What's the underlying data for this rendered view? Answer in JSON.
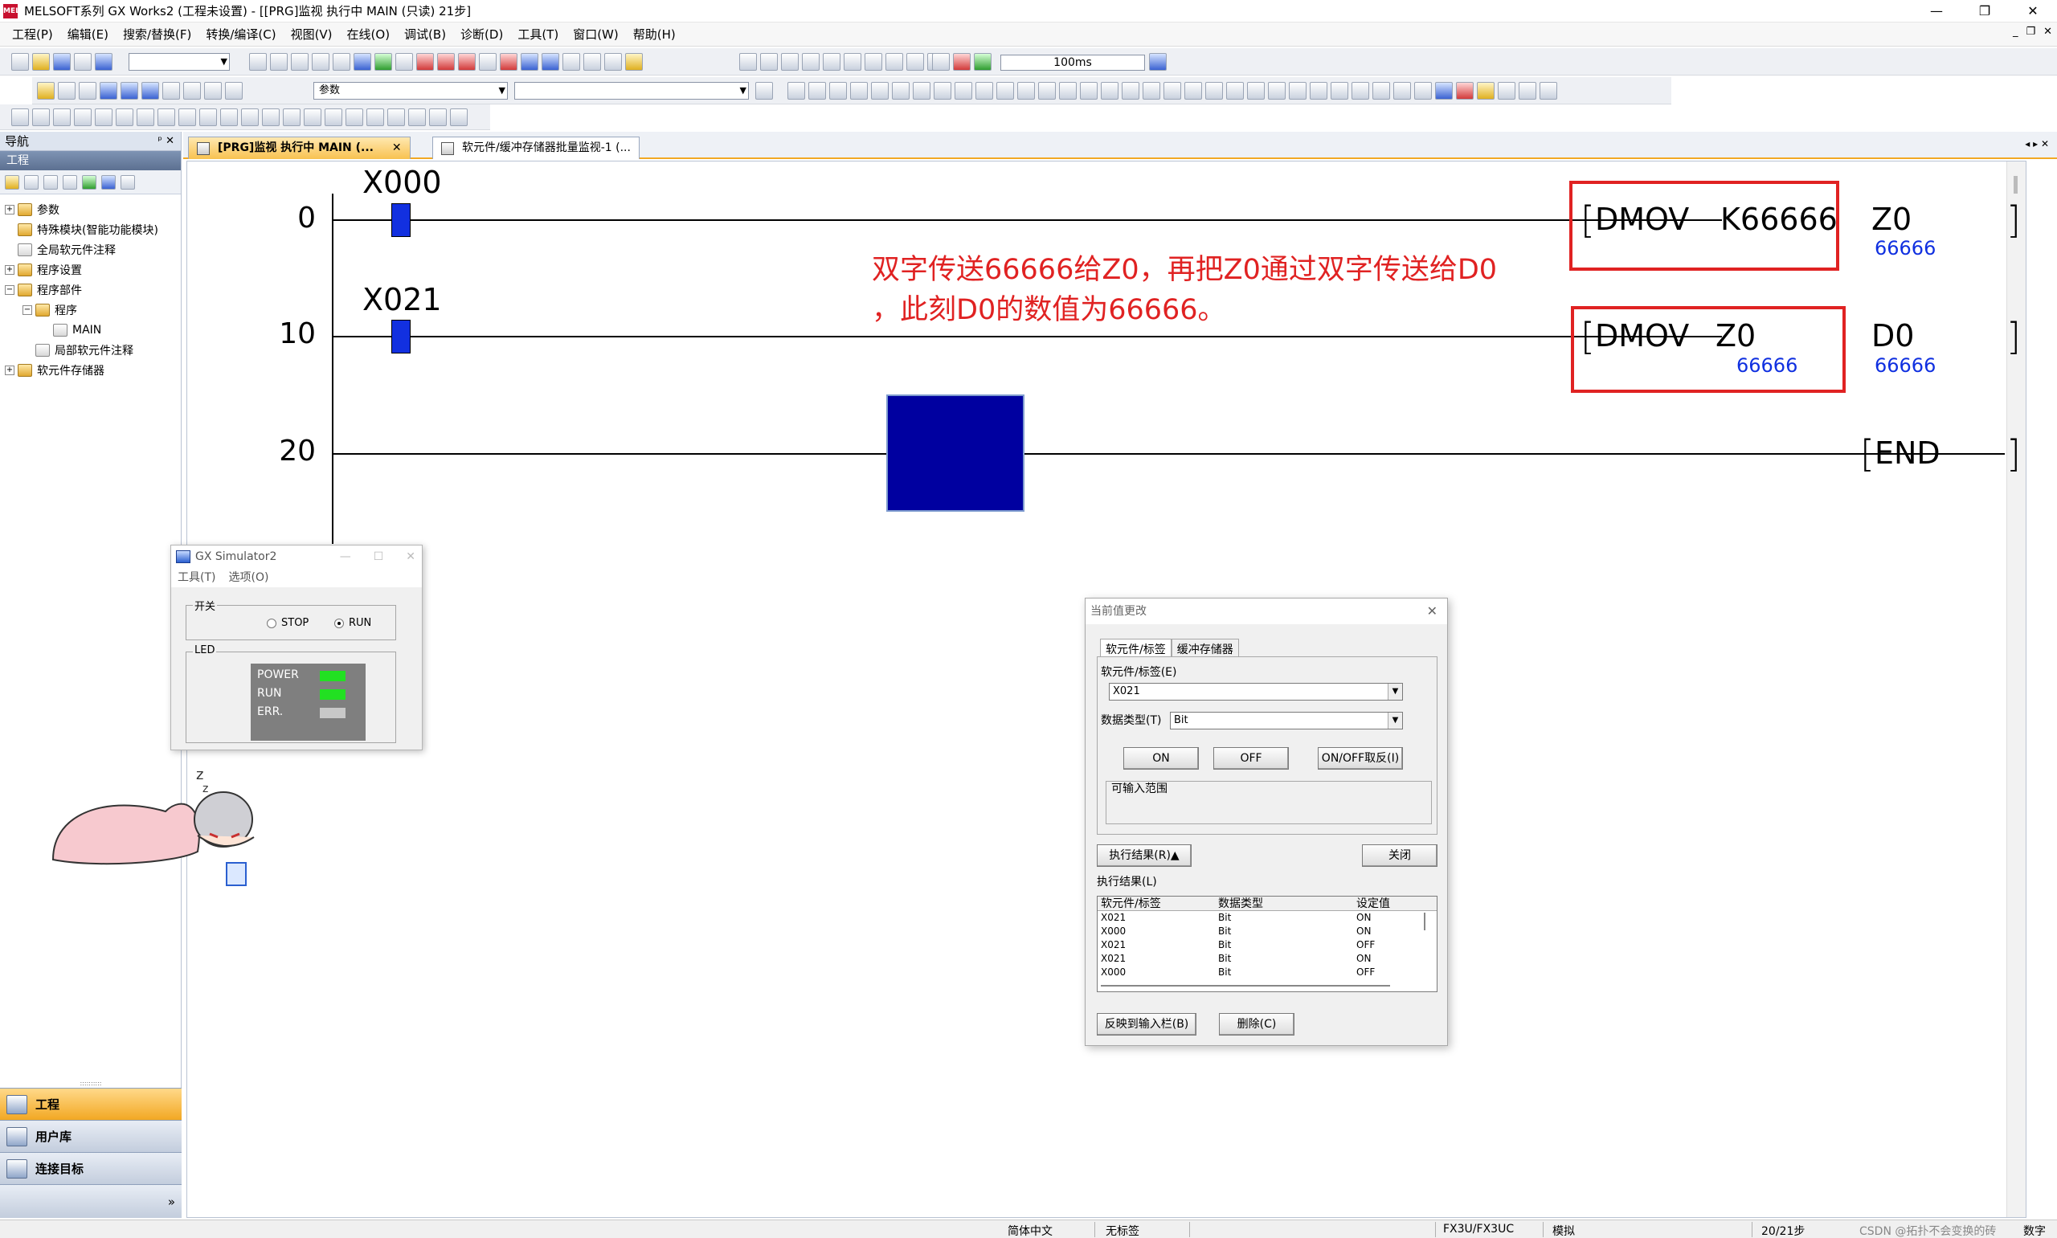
{
  "window": {
    "title": "MELSOFT系列 GX Works2 (工程未设置) - [[PRG]监视 执行中 MAIN (只读) 21步]",
    "app_icon_text": "MEL",
    "minimize": "—",
    "restore": "❐",
    "close": "✕"
  },
  "menu": [
    "工程(P)",
    "编辑(E)",
    "搜索/替换(F)",
    "转换/编译(C)",
    "视图(V)",
    "在线(O)",
    "调试(B)",
    "诊断(D)",
    "工具(T)",
    "窗口(W)",
    "帮助(H)"
  ],
  "mdi": {
    "minimize": "_",
    "restore": "❐",
    "close": "✕"
  },
  "toolbar": {
    "scan_time": "100ms",
    "param_combo": "参数"
  },
  "nav": {
    "title": "导航",
    "pin": "ᵖ ✕",
    "section": "工程",
    "tree": [
      {
        "label": "参数",
        "exp": "+",
        "indent": 0,
        "doc": false
      },
      {
        "label": "特殊模块(智能功能模块)",
        "exp": "",
        "indent": 0,
        "doc": false
      },
      {
        "label": "全局软元件注释",
        "exp": "",
        "indent": 0,
        "doc": true
      },
      {
        "label": "程序设置",
        "exp": "+",
        "indent": 0,
        "doc": false
      },
      {
        "label": "程序部件",
        "exp": "−",
        "indent": 0,
        "doc": false
      },
      {
        "label": "程序",
        "exp": "−",
        "indent": 1,
        "doc": false
      },
      {
        "label": "MAIN",
        "exp": "",
        "indent": 2,
        "doc": true
      },
      {
        "label": "局部软元件注释",
        "exp": "",
        "indent": 1,
        "doc": true
      },
      {
        "label": "软元件存储器",
        "exp": "+",
        "indent": 0,
        "doc": false
      }
    ],
    "buttons": [
      "工程",
      "用户库",
      "连接目标"
    ],
    "more": "»"
  },
  "tabs": [
    {
      "label": "[PRG]监视 执行中 MAIN (...",
      "close": "✕"
    },
    {
      "label": "软元件/缓冲存储器批量监视-1 (..."
    }
  ],
  "tab_scroll": "◂ ▸ ✕",
  "ladder": {
    "steps": [
      "0",
      "10",
      "20"
    ],
    "contacts": [
      "X000",
      "X021"
    ],
    "rung0": {
      "inst": "DMOV",
      "src": "K66666",
      "dst": "Z0",
      "dst_val": "66666"
    },
    "rung1": {
      "inst": "DMOV",
      "src": "Z0",
      "src_val": "66666",
      "dst": "D0",
      "dst_val": "66666"
    },
    "end": "END",
    "bracket_open": "[",
    "bracket_close": "]",
    "annotation_line1": "双字传送66666给Z0，再把Z0通过双字传送给D0",
    "annotation_line2": "，此刻D0的数值为66666。"
  },
  "simulator": {
    "title": "GX Simulator2",
    "buttons": {
      "min": "—",
      "max": "☐",
      "close": "✕"
    },
    "menu": [
      "工具(T)",
      "选项(O)"
    ],
    "switch_label": "开关",
    "stop": "STOP",
    "run": "RUN",
    "led_label": "LED",
    "leds": [
      {
        "name": "POWER",
        "color": "#22e022"
      },
      {
        "name": "RUN",
        "color": "#22e022"
      },
      {
        "name": "ERR.",
        "color": "#c8c8c8"
      }
    ]
  },
  "dialog": {
    "title": "当前值更改",
    "close": "✕",
    "tabs": [
      "软元件/标签",
      "缓冲存储器"
    ],
    "device_label": "软元件/标签(E)",
    "device_value": "X021",
    "dtype_label": "数据类型(T)",
    "dtype_value": "Bit",
    "on": "ON",
    "off": "OFF",
    "toggle": "ON/OFF取反(I)",
    "range_label": "可输入范围",
    "result_toggle": "执行结果(R)▲",
    "close_btn": "关闭",
    "result_label": "执行结果(L)",
    "columns": [
      "软元件/标签",
      "数据类型",
      "设定值"
    ],
    "rows": [
      [
        "X021",
        "Bit",
        "ON"
      ],
      [
        "X000",
        "Bit",
        "ON"
      ],
      [
        "X021",
        "Bit",
        "OFF"
      ],
      [
        "X021",
        "Bit",
        "ON"
      ],
      [
        "X000",
        "Bit",
        "OFF"
      ]
    ],
    "reflect_btn": "反映到输入栏(B)",
    "delete_btn": "删除(C)"
  },
  "status": {
    "lang": "简体中文",
    "label": "无标签",
    "cpu": "FX3U/FX3UC",
    "mode": "模拟",
    "steps": "20/21步",
    "watermark": "CSDN @拓扑不会变换的砖",
    "numlock": "数字"
  },
  "colors": {
    "contact_on": "#1230e0",
    "annotation": "#e02222",
    "monitor_value": "#1030e0",
    "cursor": "#0000a0"
  }
}
